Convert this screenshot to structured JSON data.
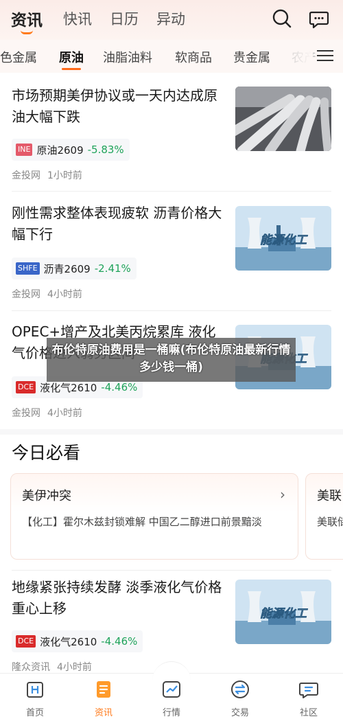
{
  "header": {
    "tabs": [
      {
        "label": "资讯",
        "active": true
      },
      {
        "label": "快讯"
      },
      {
        "label": "日历"
      },
      {
        "label": "异动"
      }
    ],
    "search_icon": "search-icon",
    "message_icon": "message-icon"
  },
  "categories": {
    "items": [
      "色金属",
      "原油",
      "油脂油料",
      "软商品",
      "贵金属",
      "农产"
    ],
    "active": "原油",
    "menu_icon": "menu-icon"
  },
  "articles": [
    {
      "title": "市场预期美伊协议或一天内达成原油大幅下跌",
      "exchange": "INE",
      "exchange_color": "#e45a6a",
      "contract": "原油2609",
      "change": "-5.83%",
      "source": "金投网",
      "time": "1小时前",
      "image": "pipelines"
    },
    {
      "title": "刚性需求整体表现疲软 沥青价格大幅下行",
      "exchange": "SHFE",
      "exchange_color": "#3a66c8",
      "contract": "沥青2609",
      "change": "-2.41%",
      "source": "金投网",
      "time": "4小时前",
      "image": "能源化工"
    },
    {
      "title": "OPEC+增产及北美丙烷累库 液化气价格进入弱势区间",
      "exchange": "DCE",
      "exchange_color": "#d92b2b",
      "contract": "液化气2610",
      "change": "-4.46%",
      "source": "金投网",
      "time": "4小时前",
      "image": "能源化工"
    },
    {
      "title": "地缘紧张持续发酵 淡季液化气价格重心上移",
      "exchange": "DCE",
      "exchange_color": "#d92b2b",
      "contract": "液化气2610",
      "change": "-4.46%",
      "source": "隆众资讯",
      "time": "4小时前",
      "image": "能源化工"
    }
  ],
  "overlay_title": "布伦特原油费用是一桶嘛(布伦特原油最新行情多少钱一桶)",
  "must_read": {
    "title": "今日必看",
    "cards": [
      {
        "title": "美伊冲突",
        "body": "【化工】霍尔木兹封锁难解 中国乙二醇进口前景黯淡"
      },
      {
        "title": "美联",
        "body": "美联储"
      }
    ]
  },
  "bottom_nav": [
    {
      "label": "首页",
      "icon": "home-icon"
    },
    {
      "label": "资讯",
      "icon": "news-icon",
      "active": true
    },
    {
      "label": "行情",
      "icon": "chart-icon"
    },
    {
      "label": "交易",
      "icon": "trade-icon"
    },
    {
      "label": "社区",
      "icon": "community-icon"
    }
  ],
  "colors": {
    "accent": "#ff7a1a",
    "down": "#1fa35a"
  }
}
